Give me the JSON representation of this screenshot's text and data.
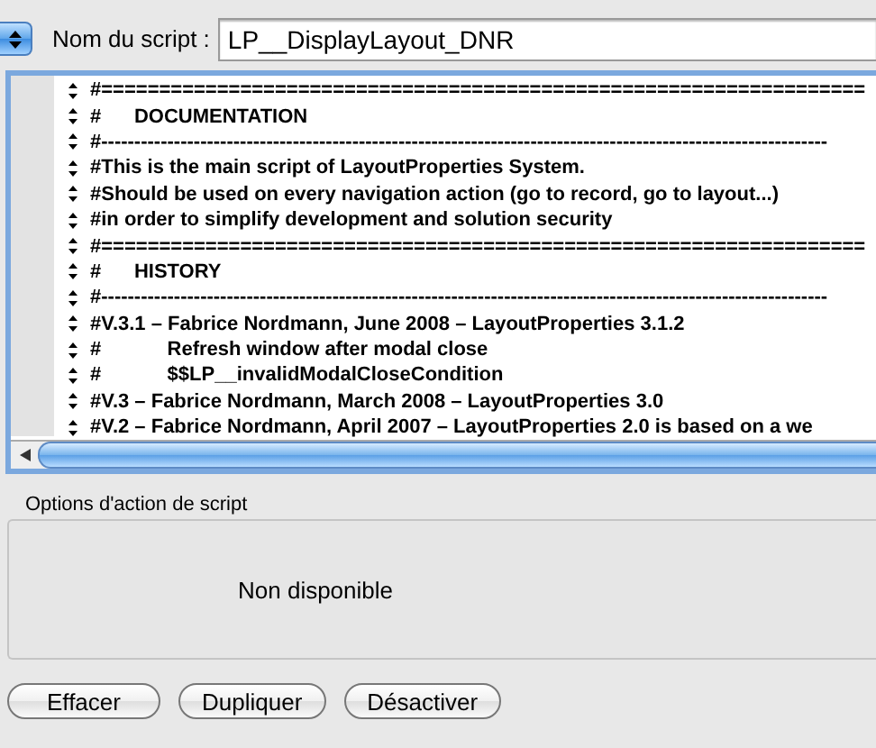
{
  "script_name": {
    "label": "Nom du script :",
    "value": "LP__DisplayLayout_DNR"
  },
  "script_lines": [
    {
      "text": "#=================================================================="
    },
    {
      "text": "#      DOCUMENTATION"
    },
    {
      "text": "#--------------------------------------------------------------------------------------------------------------"
    },
    {
      "text": "#This is the main script of LayoutProperties System."
    },
    {
      "text": "#Should be used on every navigation action (go to record, go to layout...)"
    },
    {
      "text": "#in order to simplify development and solution security"
    },
    {
      "text": "#=================================================================="
    },
    {
      "text": "#      HISTORY"
    },
    {
      "text": "#--------------------------------------------------------------------------------------------------------------"
    },
    {
      "text": "#V.3.1 – Fabrice Nordmann, June 2008 – LayoutProperties 3.1.2"
    },
    {
      "text": "#            Refresh window after modal close"
    },
    {
      "text": "#            $$LP__invalidModalCloseCondition"
    },
    {
      "text": "#V.3 – Fabrice Nordmann, March 2008 – LayoutProperties 3.0"
    },
    {
      "text": "#V.2 – Fabrice Nordmann, April 2007 – LayoutProperties 2.0 is based on a we"
    }
  ],
  "options": {
    "title": "Options d'action de script",
    "message": "Non disponible"
  },
  "buttons": [
    "Effacer",
    "Dupliquer",
    "Désactiver"
  ]
}
